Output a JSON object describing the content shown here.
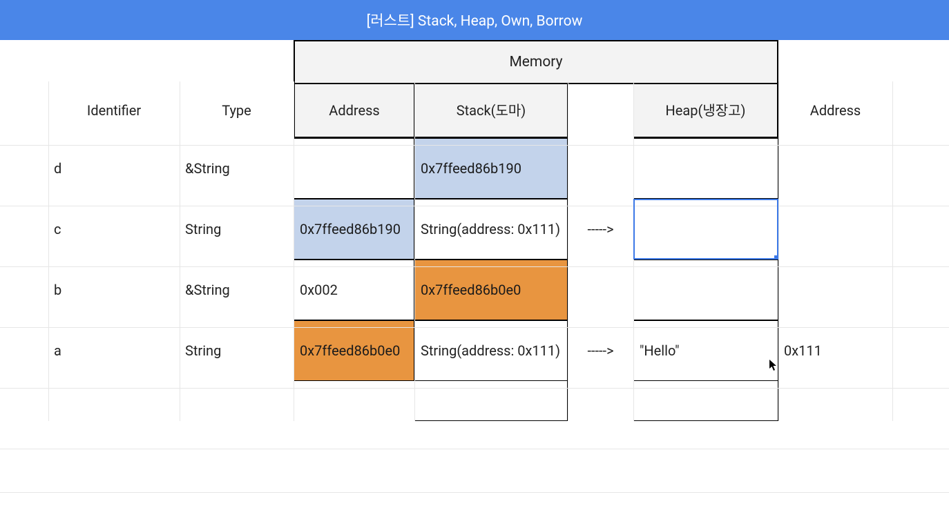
{
  "banner": {
    "title": "[러스트] Stack, Heap, Own, Borrow"
  },
  "headers": {
    "memory": "Memory",
    "identifier": "Identifier",
    "type": "Type",
    "address": "Address",
    "stack": "Stack(도마)",
    "heap": "Heap(냉장고)",
    "address2": "Address"
  },
  "rows": [
    {
      "id": "a",
      "type": "String",
      "address": "0x7ffeed86b0e0",
      "stack": "String(address: 0x111)",
      "arrow": "----->",
      "heap": "\"Hello\"",
      "address2": "0x111",
      "address_style": "orange",
      "stack_style": ""
    },
    {
      "id": "b",
      "type": "&String",
      "address": "0x002",
      "stack": "0x7ffeed86b0e0",
      "arrow": "",
      "heap": "",
      "address2": "",
      "address_style": "",
      "stack_style": "orange"
    },
    {
      "id": "c",
      "type": "String",
      "address": "0x7ffeed86b190",
      "stack": "String(address: 0x111)",
      "arrow": "----->",
      "heap": "",
      "address2": "",
      "address_style": "blue",
      "stack_style": ""
    },
    {
      "id": "d",
      "type": "&String",
      "address": "",
      "stack": "0x7ffeed86b190",
      "arrow": "",
      "heap": "",
      "address2": "",
      "address_style": "",
      "stack_style": "blue"
    }
  ],
  "selection": {
    "row": 2,
    "col": "heap"
  },
  "chart_data": {
    "type": "table",
    "title": "[러스트] Stack, Heap, Own, Borrow",
    "columns": [
      "Identifier",
      "Type",
      "Address",
      "Stack(도마)",
      "",
      "Heap(냉장고)",
      "Address"
    ],
    "rows": [
      [
        "a",
        "String",
        "0x7ffeed86b0e0",
        "String(address: 0x111)",
        "----->",
        "\"Hello\"",
        "0x111"
      ],
      [
        "b",
        "&String",
        "0x002",
        "0x7ffeed86b0e0",
        "",
        "",
        ""
      ],
      [
        "c",
        "String",
        "0x7ffeed86b190",
        "String(address: 0x111)",
        "----->",
        "",
        ""
      ],
      [
        "d",
        "&String",
        "",
        "0x7ffeed86b190",
        "",
        "",
        ""
      ]
    ]
  }
}
